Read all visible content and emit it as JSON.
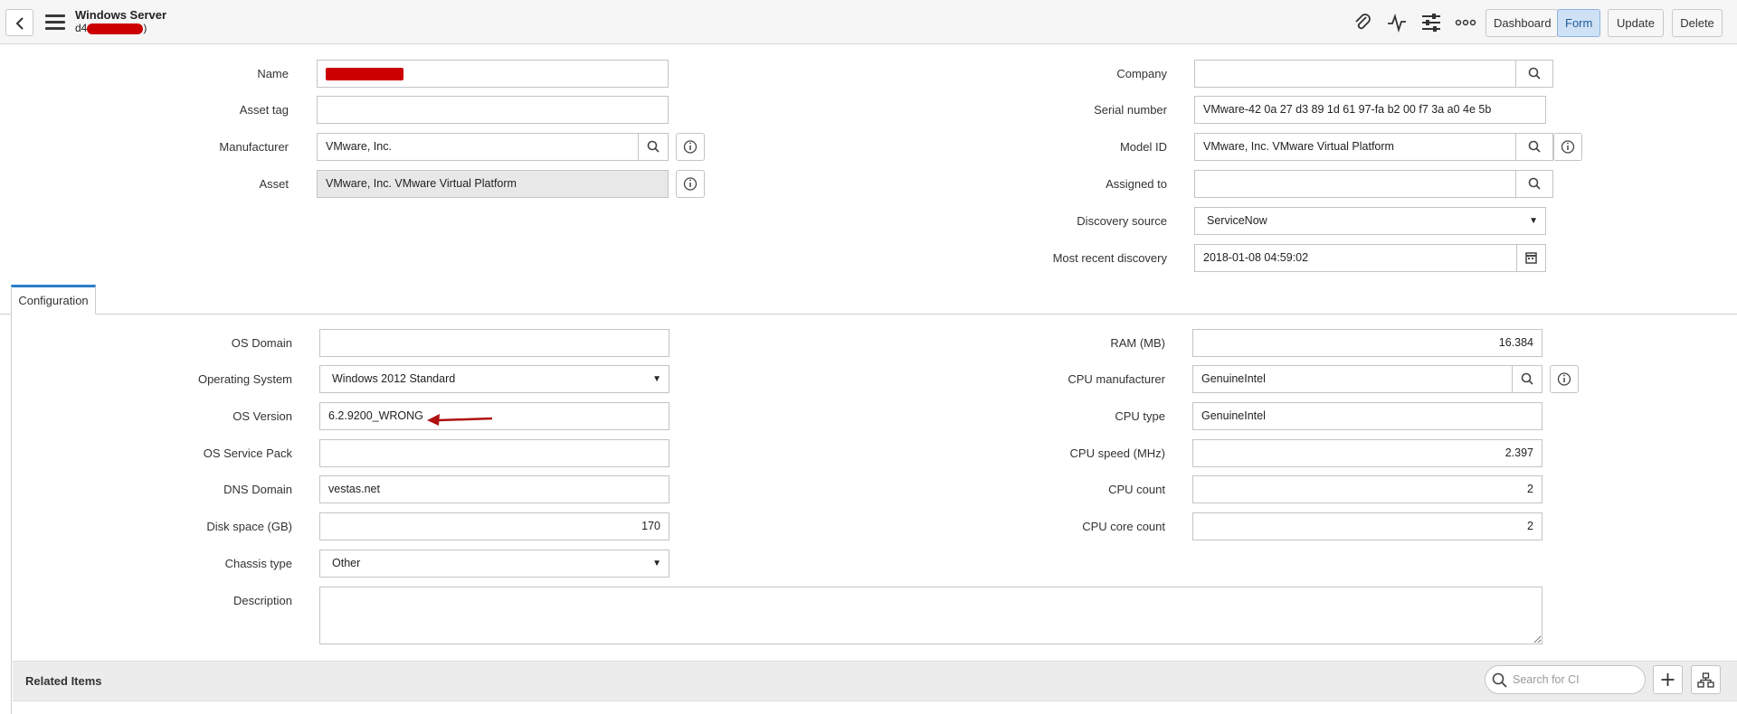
{
  "header": {
    "title": "Windows Server",
    "subtitle_prefix": "d4",
    "subtitle_suffix": ")",
    "buttons": {
      "dashboard": "Dashboard",
      "form": "Form",
      "update": "Update",
      "delete": "Delete"
    },
    "icons": [
      "back-icon",
      "menu-icon",
      "attachment-icon",
      "activity-icon",
      "settings-sliders-icon",
      "more-icon"
    ]
  },
  "main": {
    "name": {
      "label": "Name",
      "value": ""
    },
    "asset_tag": {
      "label": "Asset tag",
      "value": ""
    },
    "manufacturer": {
      "label": "Manufacturer",
      "value": "VMware, Inc."
    },
    "asset": {
      "label": "Asset",
      "value": "VMware, Inc. VMware Virtual Platform"
    },
    "company": {
      "label": "Company",
      "value": ""
    },
    "serial_number": {
      "label": "Serial number",
      "value": "VMware-42 0a 27 d3 89 1d 61 97-fa b2 00 f7 3a a0 4e 5b"
    },
    "model_id": {
      "label": "Model ID",
      "value": "VMware, Inc. VMware Virtual Platform"
    },
    "assigned_to": {
      "label": "Assigned to",
      "value": ""
    },
    "discovery_source": {
      "label": "Discovery source",
      "value": "ServiceNow"
    },
    "most_recent_discovery": {
      "label": "Most recent discovery",
      "value": "2018-01-08 04:59:02"
    }
  },
  "tabs": [
    {
      "label": "Configuration"
    }
  ],
  "config": {
    "os_domain": {
      "label": "OS Domain",
      "value": ""
    },
    "operating_system": {
      "label": "Operating System",
      "value": "Windows 2012 Standard"
    },
    "os_version": {
      "label": "OS Version",
      "value": "6.2.9200_WRONG"
    },
    "os_service_pack": {
      "label": "OS Service Pack",
      "value": ""
    },
    "dns_domain": {
      "label": "DNS Domain",
      "value": "vestas.net"
    },
    "disk_space": {
      "label": "Disk space (GB)",
      "value": "170"
    },
    "chassis_type": {
      "label": "Chassis type",
      "value": "Other"
    },
    "description": {
      "label": "Description",
      "value": ""
    },
    "ram": {
      "label": "RAM (MB)",
      "value": "16.384"
    },
    "cpu_manufacturer": {
      "label": "CPU manufacturer",
      "value": "GenuineIntel"
    },
    "cpu_type": {
      "label": "CPU type",
      "value": "GenuineIntel"
    },
    "cpu_speed": {
      "label": "CPU speed (MHz)",
      "value": "2.397"
    },
    "cpu_count": {
      "label": "CPU count",
      "value": "2"
    },
    "cpu_core_count": {
      "label": "CPU core count",
      "value": "2"
    }
  },
  "related": {
    "label": "Related Items",
    "search_placeholder": "Search for CI"
  },
  "colors": {
    "accent": "#2a7dc9",
    "redaction": "#cc0000",
    "annotation_arrow": "#b01010"
  }
}
